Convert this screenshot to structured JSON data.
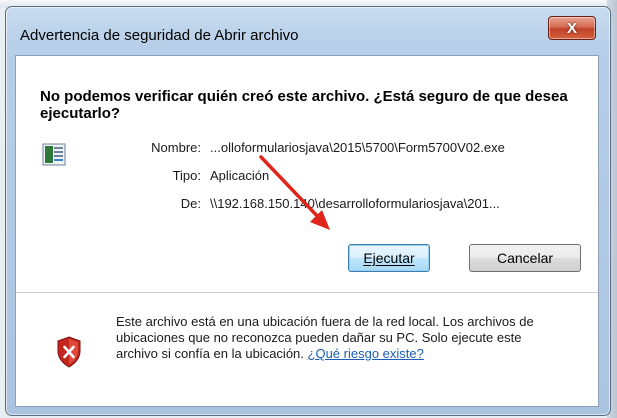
{
  "window": {
    "title": "Advertencia de seguridad de Abrir archivo",
    "close_label": "X"
  },
  "dialog": {
    "heading": "No podemos verificar quién creó este archivo. ¿Está seguro de que desea ejecutarlo?",
    "details": {
      "name_label": "Nombre:",
      "name_value": "...olloformulariosjava\\2015\\5700\\Form5700V02.exe",
      "type_label": "Tipo:",
      "type_value": "Aplicación",
      "from_label": "De:",
      "from_value": "\\\\192.168.150.140\\desarrolloformulariosjava\\201..."
    },
    "buttons": {
      "run": "Ejecutar",
      "cancel": "Cancelar"
    },
    "warning": {
      "text": "Este archivo está en una ubicación fuera de la red local. Los archivos de ubicaciones que no reconozca pueden dañar su PC. Solo ejecute este archivo si confía en la ubicación.",
      "link": "¿Qué riesgo existe?"
    }
  },
  "colors": {
    "accent_arrow": "#e0261b",
    "link": "#1a5fb4",
    "close_button": "#c8452d"
  },
  "icons": [
    "close-icon",
    "file-icon",
    "shield-warning-icon",
    "red-arrow-annotation"
  ]
}
